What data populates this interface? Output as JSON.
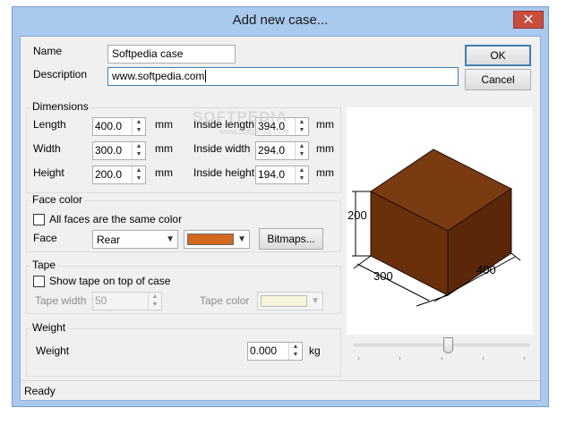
{
  "window": {
    "title": "Add new case...",
    "close_glyph": "✕"
  },
  "name": {
    "label": "Name",
    "value": "Softpedia case"
  },
  "description": {
    "label": "Description",
    "value": "www.softpedia.com"
  },
  "buttons": {
    "ok": "OK",
    "cancel": "Cancel",
    "bitmaps": "Bitmaps..."
  },
  "dimensions": {
    "title": "Dimensions",
    "unit": "mm",
    "length": {
      "label": "Length",
      "value": "400.0"
    },
    "width": {
      "label": "Width",
      "value": "300.0"
    },
    "height": {
      "label": "Height",
      "value": "200.0"
    },
    "inside_length": {
      "label": "Inside length",
      "value": "394.0"
    },
    "inside_width": {
      "label": "Inside width",
      "value": "294.0"
    },
    "inside_height": {
      "label": "Inside height",
      "value": "194.0"
    }
  },
  "face_color": {
    "title": "Face color",
    "same_color_label": "All faces are the same color",
    "same_color_checked": false,
    "face_label": "Face",
    "face_value": "Rear",
    "color": "#d2691e"
  },
  "tape": {
    "title": "Tape",
    "show_label": "Show tape on top of case",
    "show_checked": false,
    "width_label": "Tape width",
    "width_value": "50",
    "color_label": "Tape color",
    "color": "#f6f5dc"
  },
  "weight": {
    "title": "Weight",
    "label": "Weight",
    "value": "0.000",
    "unit": "kg"
  },
  "preview": {
    "dim_height": "200",
    "dim_width": "300",
    "dim_length": "400",
    "top_color": "#7a3a12",
    "front_color": "#6a2f0b",
    "side_color": "#5a270a",
    "slider_value": 0.54
  },
  "watermark": {
    "text": "SOFTPEDIA",
    "subtext": "www.softpedia.com"
  },
  "status": {
    "text": "Ready"
  }
}
